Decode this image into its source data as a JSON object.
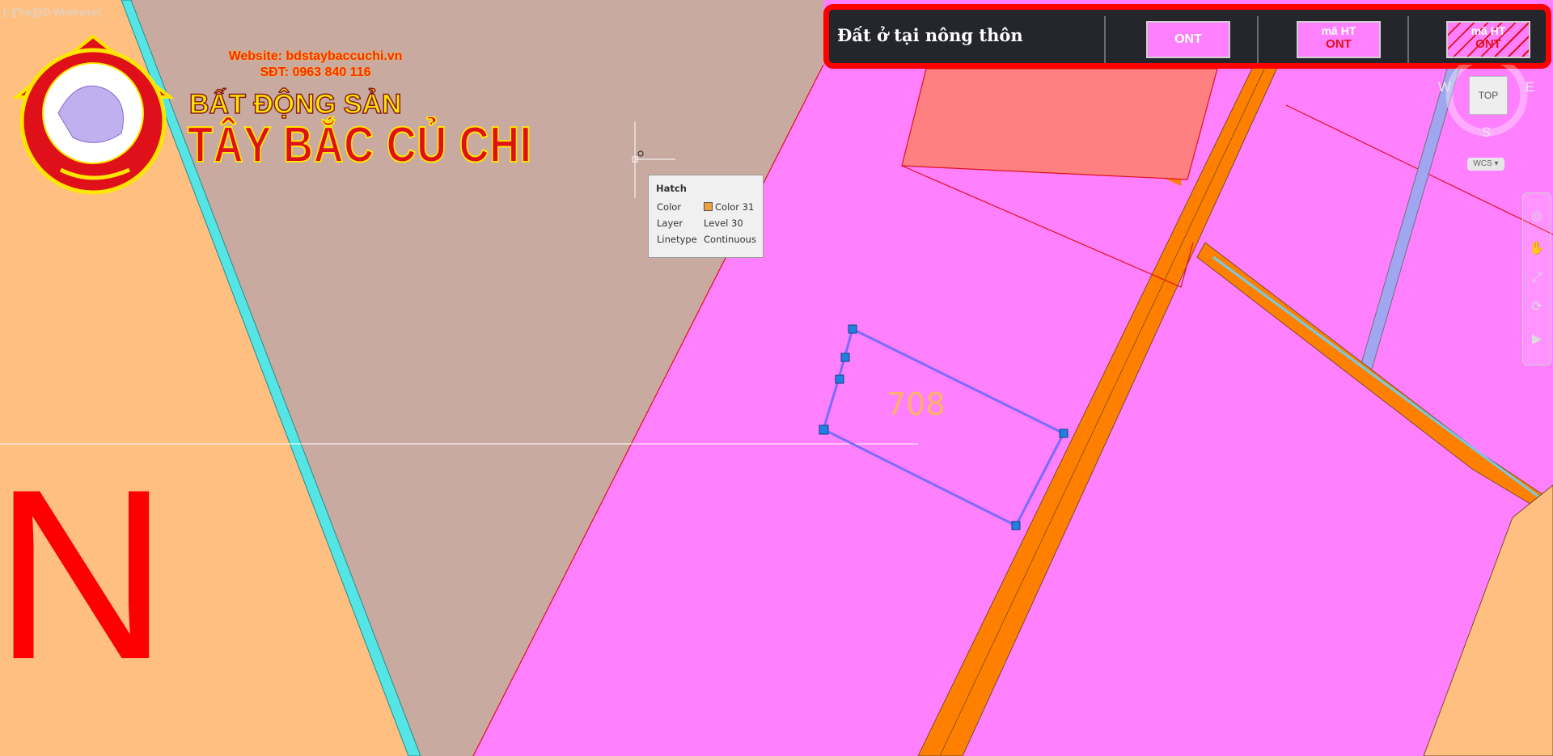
{
  "viewport": {
    "label": "[−][Top][2D Wireframe]"
  },
  "logo": {
    "website": "Website: bdstaybaccuchi.vn",
    "phone": "SĐT: 0963 840 116",
    "brand_line1": "BẤT ĐỘNG SẢN",
    "brand_line2": "TÂY BẮC CỦ CHI"
  },
  "tooltip": {
    "title": "Hatch",
    "rows": [
      {
        "key": "Color",
        "value": "Color 31"
      },
      {
        "key": "Layer",
        "value": "Level 30"
      },
      {
        "key": "Linetype",
        "value": "Continuous"
      }
    ]
  },
  "parcel": {
    "number": "708"
  },
  "north_marker": "N",
  "legend": {
    "title": "Đất ở tại nông thôn",
    "swatch1": "ONT",
    "swatch2_top": "mã HT",
    "swatch2_bottom": "ONT",
    "swatch3_top": "mã HT",
    "swatch3_bottom": "ONT"
  },
  "viewcube": {
    "west": "W",
    "east": "E",
    "south": "S",
    "top": "TOP",
    "wcs": "WCS ▾"
  },
  "colors": {
    "ont": "#ff80ff",
    "road": "#ff8000",
    "agri": "#ffbf80",
    "other": "#c8aaa0",
    "selection": "#7a6bff",
    "legend_border": "#ff0000"
  }
}
